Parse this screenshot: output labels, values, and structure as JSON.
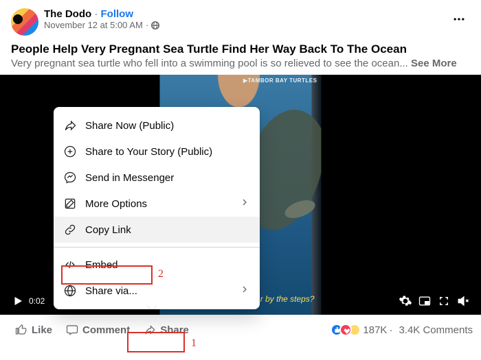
{
  "header": {
    "page_name": "The Dodo",
    "follow_label": "Follow",
    "separator": " · ",
    "timestamp": "November 12 at 5:00 AM",
    "privacy_icon": "public-globe"
  },
  "post": {
    "title": "People Help Very Pregnant Sea Turtle Find Her Way Back To The Ocean",
    "description": "Very pregnant sea turtle who fell into a swimming pool is so relieved to see the ocean... ",
    "see_more": "See More"
  },
  "video": {
    "watermark": "▶TAMBOR BAY TURTLES",
    "caption": "r by the steps?",
    "current_time": "0:02"
  },
  "actions": {
    "like": "Like",
    "comment": "Comment",
    "share": "Share"
  },
  "stats": {
    "reactions_count": "187K",
    "comments_count": "3.4K Comments"
  },
  "share_menu": {
    "share_now": "Share Now (Public)",
    "share_story": "Share to Your Story (Public)",
    "send_messenger": "Send in Messenger",
    "more_options": "More Options",
    "copy_link": "Copy Link",
    "embed": "Embed",
    "share_via": "Share via..."
  },
  "annotations": {
    "n1": "1",
    "n2": "2"
  }
}
